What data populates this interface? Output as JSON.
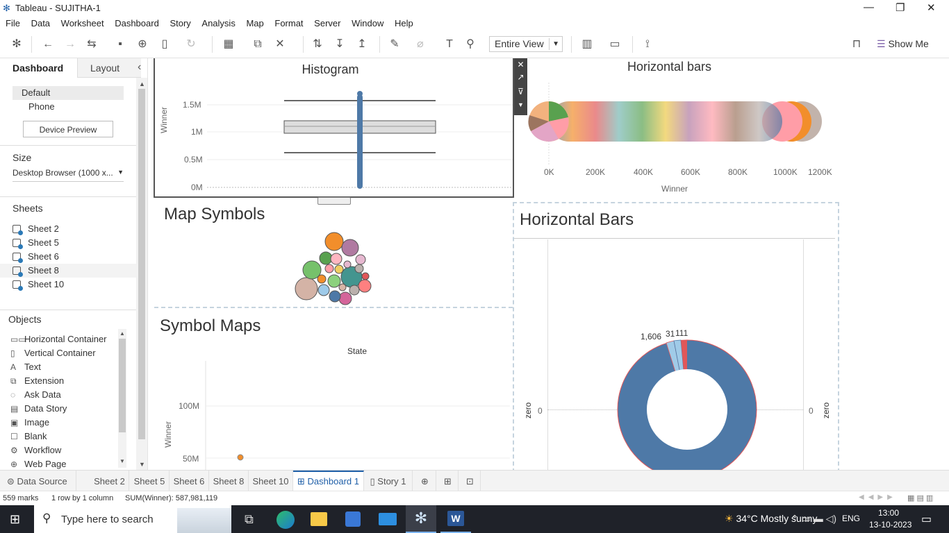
{
  "window": {
    "title": "Tableau - SUJITHA-1",
    "minimize": "—",
    "restore": "❐",
    "close": "✕"
  },
  "menu": [
    "File",
    "Data",
    "Worksheet",
    "Dashboard",
    "Story",
    "Analysis",
    "Map",
    "Format",
    "Server",
    "Window",
    "Help"
  ],
  "toolbar": {
    "fit_value": "Entire View",
    "show_me": "Show Me"
  },
  "left_pane": {
    "tabs": {
      "dashboard": "Dashboard",
      "layout": "Layout",
      "collapse": "‹"
    },
    "devices": [
      "Default",
      "Phone"
    ],
    "device_preview": "Device Preview",
    "size_header": "Size",
    "size_value": "Desktop Browser (1000 x...",
    "sheets_header": "Sheets",
    "sheets": [
      "Sheet 2",
      "Sheet 5",
      "Sheet 6",
      "Sheet 8",
      "Sheet 10"
    ],
    "objects_header": "Objects",
    "objects": [
      {
        "label": "Horizontal Container",
        "icon": "horizontal-container-icon",
        "glyph": "▭▭"
      },
      {
        "label": "Vertical Container",
        "icon": "vertical-container-icon",
        "glyph": "▯"
      },
      {
        "label": "Text",
        "icon": "text-icon",
        "glyph": "A"
      },
      {
        "label": "Extension",
        "icon": "extension-icon",
        "glyph": "⧉"
      },
      {
        "label": "Ask Data",
        "icon": "ask-data-icon",
        "glyph": "◌"
      },
      {
        "label": "Data Story",
        "icon": "data-story-icon",
        "glyph": "▤"
      },
      {
        "label": "Image",
        "icon": "image-icon",
        "glyph": "▣"
      },
      {
        "label": "Blank",
        "icon": "blank-icon",
        "glyph": "☐"
      },
      {
        "label": "Workflow",
        "icon": "workflow-icon",
        "glyph": "⚙"
      },
      {
        "label": "Web Page",
        "icon": "web-page-icon",
        "glyph": "⊕"
      }
    ]
  },
  "dashboard": {
    "histogram": {
      "title": "Histogram",
      "y_label": "Winner",
      "ticks": [
        "1.5M",
        "1M",
        "0.5M",
        "0M"
      ]
    },
    "horizontal_bars_top": {
      "title": "Horizontal bars",
      "x_label": "Winner",
      "ticks": [
        "0K",
        "200K",
        "400K",
        "600K",
        "800K",
        "1000K",
        "1200K"
      ]
    },
    "map_symbols": {
      "title": "Map Symbols"
    },
    "symbol_maps": {
      "title": "Symbol Maps",
      "col_header": "State",
      "y_label": "Winner",
      "ticks": [
        "100M",
        "50M"
      ]
    },
    "horizontal_bars_donut": {
      "title": "Horizontal Bars",
      "labels": [
        "1,606",
        "31",
        "111"
      ],
      "left_axis": "zero",
      "right_axis": "zero",
      "left_zero": "0",
      "right_zero": "0"
    }
  },
  "bottom_tabs": [
    "Data Source",
    "Sheet 2",
    "Sheet 5",
    "Sheet 6",
    "Sheet 8",
    "Sheet 10",
    "Dashboard 1",
    "Story 1"
  ],
  "active_tab": "Dashboard 1",
  "status": {
    "marks": "559 marks",
    "rows": "1 row by 1 column",
    "sum": "SUM(Winner): 587,981,119"
  },
  "taskbar": {
    "search_placeholder": "Type here to search",
    "weather": "34°C  Mostly sunny",
    "lang": "ENG",
    "time": "13:00",
    "date": "13-10-2023"
  }
}
